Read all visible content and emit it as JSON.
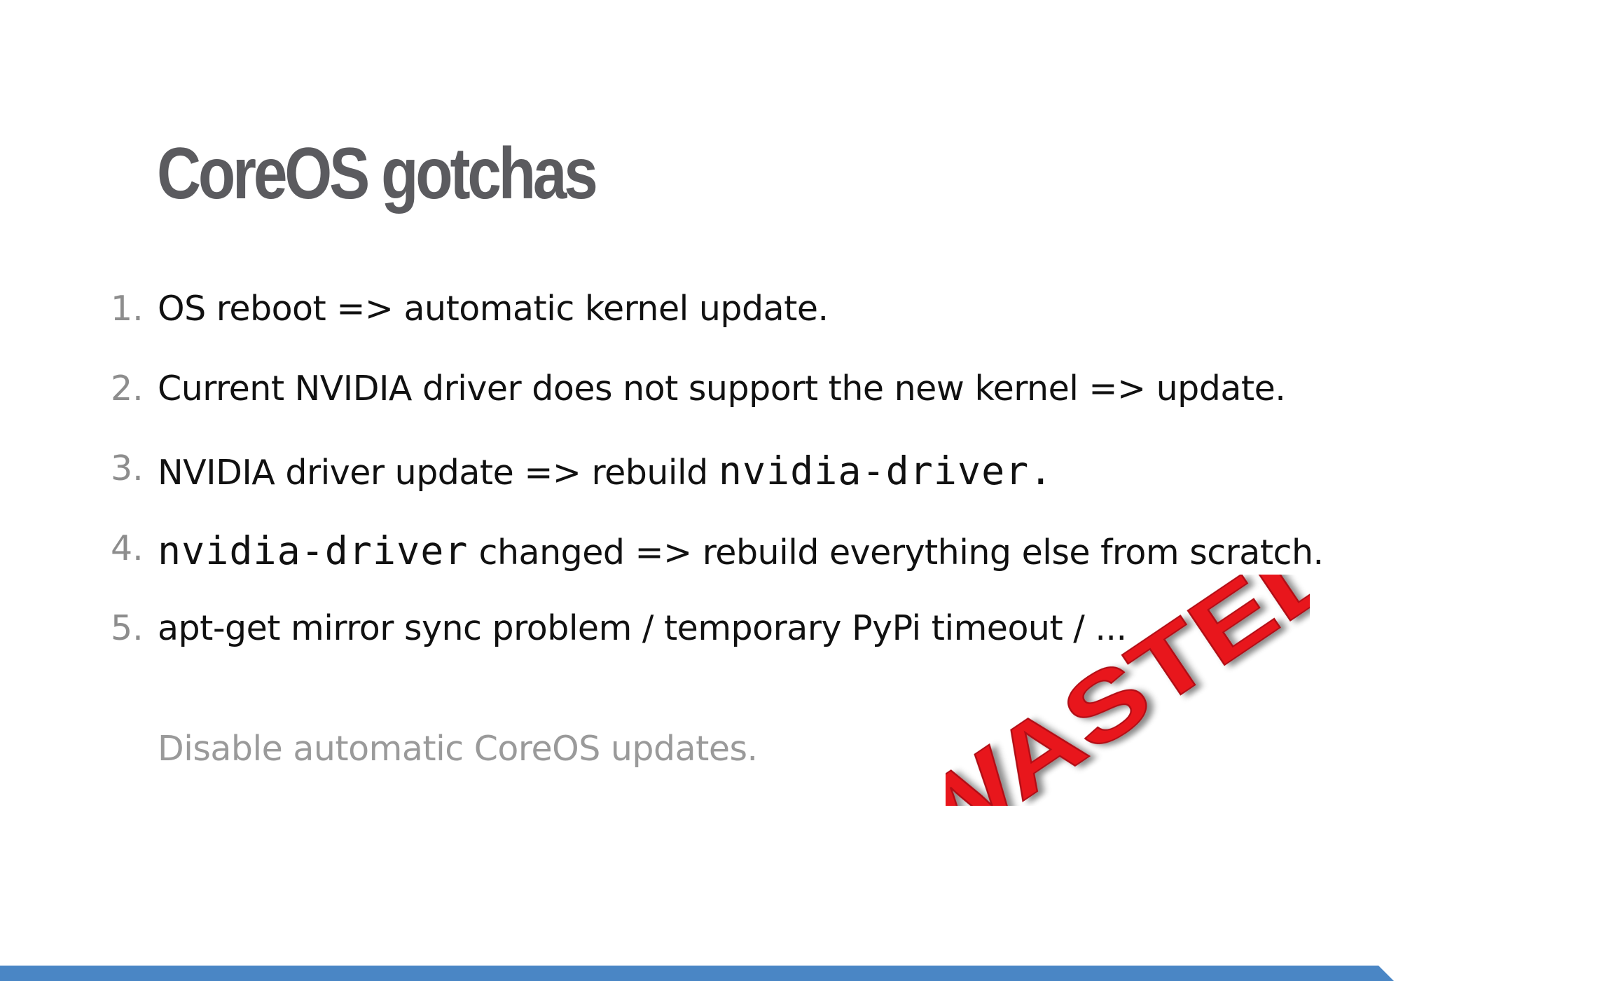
{
  "slide": {
    "title": "CoreOS gotchas",
    "items": [
      {
        "number": "1.",
        "text": "OS reboot => automatic kernel update."
      },
      {
        "number": "2.",
        "text": "Current NVIDIA driver does not support the new kernel => update."
      },
      {
        "number": "3.",
        "text": "NVIDIA driver update => rebuild ",
        "code": "nvidia-driver."
      },
      {
        "number": "4.",
        "code": "nvidia-driver",
        "text": " changed => rebuild everything else from scratch."
      },
      {
        "number": "5.",
        "text": "apt-get mirror sync problem / temporary PyPi timeout / ..."
      }
    ],
    "note": "Disable automatic CoreOS updates.",
    "stamp_text": "WASTED"
  },
  "colors": {
    "title": "#5b5b5f",
    "body_text": "#111111",
    "list_numbers": "#8d8d8d",
    "note_text": "#9a9a9a",
    "stamp_red": "#e8161b",
    "bottom_bar": "#4a86c5"
  }
}
